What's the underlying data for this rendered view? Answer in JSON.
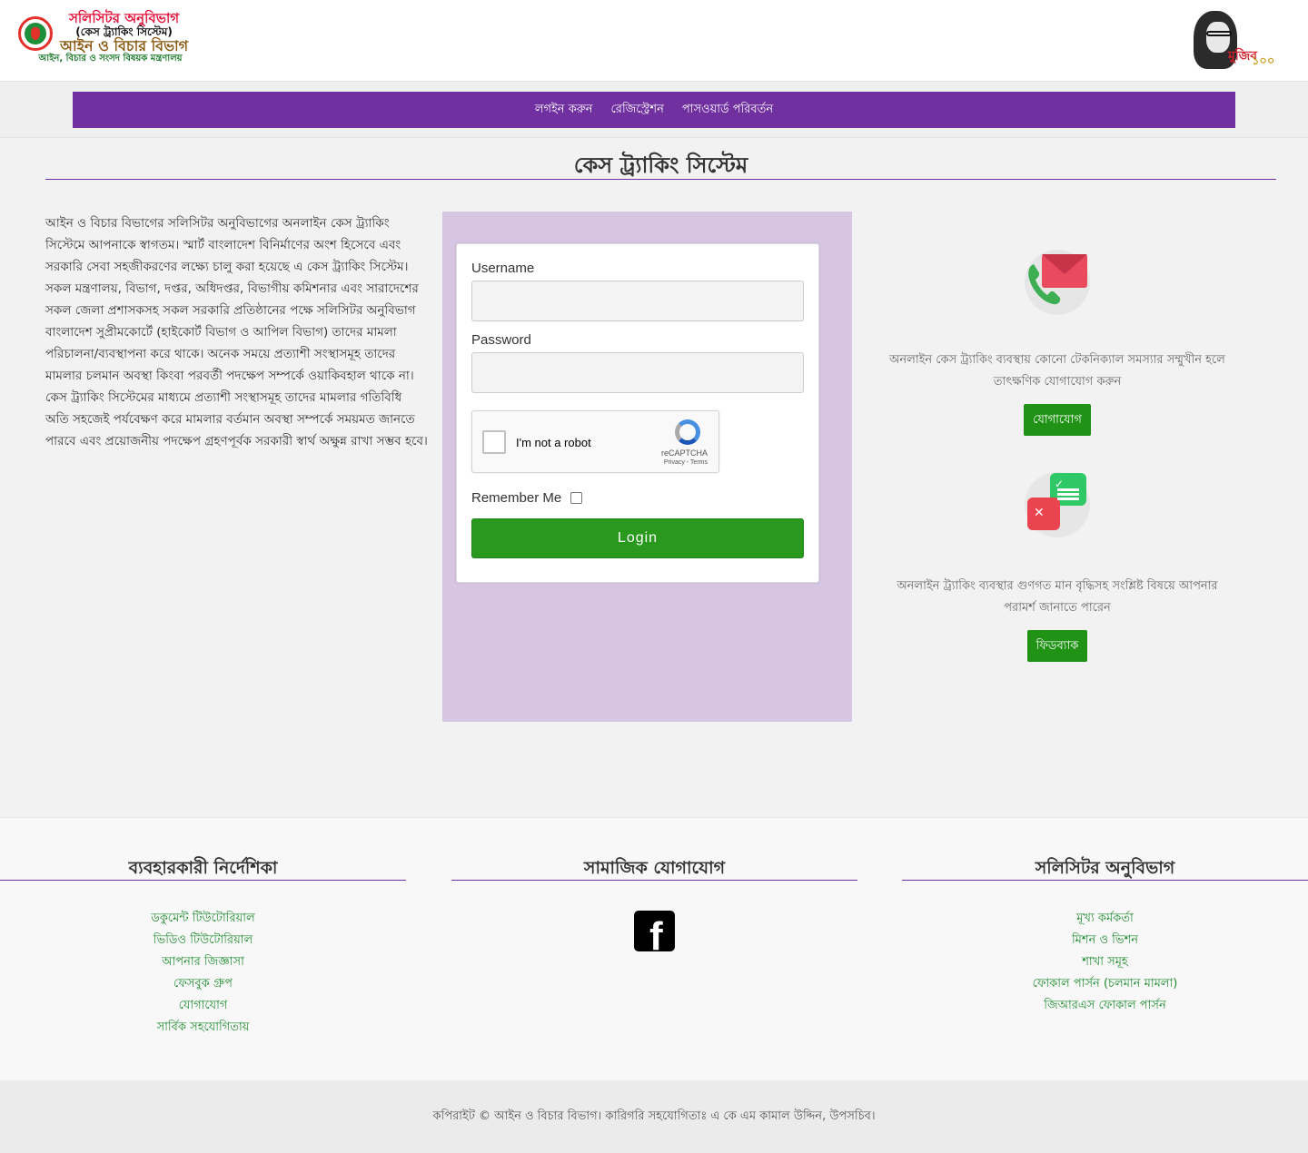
{
  "brand": {
    "line1": "সলিসিটর অনুবিভাগ",
    "line2": "(কেস ট্র্যাকিং সিস্টেম)",
    "line3": "আইন ও বিচার বিভাগ",
    "line4": "আইন, বিচার ও সংসদ বিষয়ক মন্ত্রণালয়"
  },
  "mujib_logo": {
    "text": "মুজিব",
    "sub": "১০০"
  },
  "nav": {
    "items": [
      "লগইন করুন",
      "রেজিস্ট্রেশন",
      "পাসওয়ার্ড পরিবর্তন"
    ]
  },
  "page": {
    "title": "কেস ট্র্যাকিং সিস্টেম"
  },
  "intro": "আইন ও বিচার বিভাগের সলিসিটর অনুবিভাগের অনলাইন কেস ট্র্যাকিং সিস্টেমে আপনাকে স্বাগতম। স্মার্ট বাংলাদেশ বিনির্মাণের অংশ হিসেবে এবং সরকারি সেবা সহজীকরণের লক্ষ্যে চালু করা হয়েছে এ কেস ট্র্যাকিং সিস্টেম। সকল মন্ত্রণালয়, বিভাগ, দপ্তর, অধিদপ্তর, বিভাগীয় কমিশনার এবং সারাদেশের সকল জেলা প্রশাসকসহ সকল সরকারি প্রতিষ্ঠানের পক্ষে সলিসিটর অনুবিভাগ বাংলাদেশ সুপ্রীমকোর্টে (হাইকোর্ট বিভাগ ও আপিল বিভাগ) তাদের মামলা পরিচালনা/ব্যবস্থাপনা করে থাকে। অনেক সময়ে প্রত্যাশী সংস্থাসমূহ তাদের মামলার চলমান অবস্থা কিংবা পরবর্তী পদক্ষেপ সম্পর্কে ওয়াকিবহাল থাকে না। কেস ট্র্যাকিং সিস্টেমের মাধ্যমে প্রত্যাশী সংস্থাসমূহ তাদের মামলার গতিবিধি অতি সহজেই পর্যবেক্ষণ করে মামলার বর্তমান অবস্থা সম্পর্কে সময়মত জানতে পারবে এবং প্রয়োজনীয় পদক্ষেপ গ্রহণপূর্বক সরকারী স্বার্থ অক্ষুন্ন রাখা সম্ভব হবে।",
  "login": {
    "username_label": "Username",
    "username_value": "",
    "password_label": "Password",
    "password_value": "",
    "captcha_text": "I'm not a robot",
    "captcha_brand": "reCAPTCHA",
    "captcha_terms": "Privacy - Terms",
    "remember_label": "Remember Me",
    "remember_checked": false,
    "submit_label": "Login"
  },
  "support": {
    "contact_text": "অনলাইন কেস ট্র্যাকিং ব্যবস্থায় কোনো টেকনিক্যাল সমস্যার সম্মুখীন হলে তাৎক্ষণিক যোগাযোগ করুন",
    "contact_button": "যোগাযোগ",
    "feedback_text": "অনলাইন ট্র্যাকিং ব্যবস্থার গুণগত মান বৃদ্ধিসহ সংশ্লিষ্ট বিষয়ে আপনার পরামর্শ জানাতে পারেন",
    "feedback_button": "ফিডব্যাক"
  },
  "footer": {
    "guide": {
      "title": "ব্যবহারকারী নির্দেশিকা",
      "links": [
        "ডকুমেন্ট টিউটোরিয়াল",
        "ভিডিও টিউটোরিয়াল",
        "আপনার জিজ্ঞাসা",
        "ফেসবুক গ্রুপ",
        "যোগাযোগ",
        "সার্বিক সহযোগিতায়"
      ]
    },
    "social": {
      "title": "সামাজিক যোগাযোগ",
      "icon": "facebook-icon"
    },
    "solicitor": {
      "title": "সলিসিটর অনুবিভাগ",
      "links": [
        "মূখ্য কর্মকর্তা",
        "মিশন ও ভিশন",
        "শাখা সমূহ",
        "ফোকাল পার্সন (চলমান মামলা)",
        "জিআরএস ফোকাল পার্সন"
      ]
    },
    "copyright": "কপিরাইট © আইন ও বিচার বিভাগ।  কারিগরি সহযোগিতাঃ এ কে এম কামাল উদ্দিন, উপসচিব।"
  },
  "colors": {
    "nav_bg": "#7030a0",
    "login_panel_bg": "#d6c5e3",
    "button_green": "#28991c",
    "link_green": "#1d8a2e",
    "brand_red": "#e2143b"
  }
}
